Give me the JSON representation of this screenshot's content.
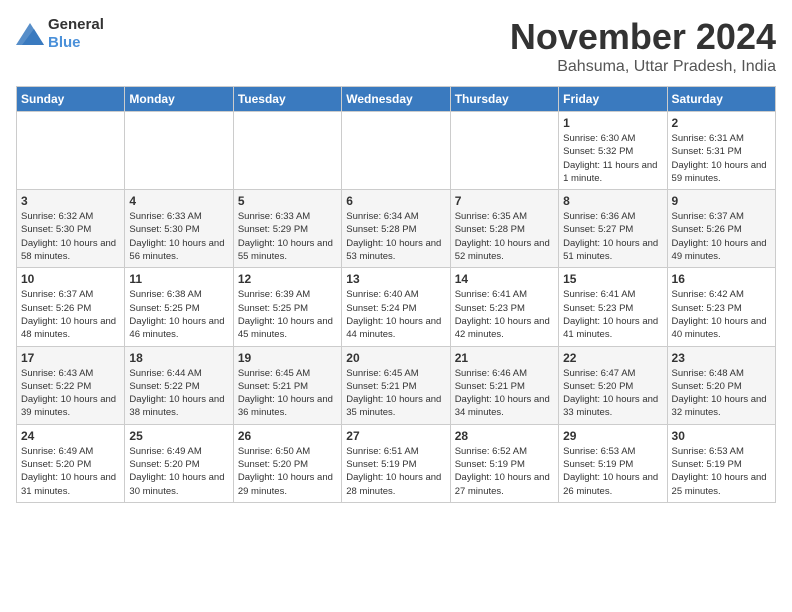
{
  "logo": {
    "general": "General",
    "blue": "Blue"
  },
  "header": {
    "month": "November 2024",
    "location": "Bahsuma, Uttar Pradesh, India"
  },
  "weekdays": [
    "Sunday",
    "Monday",
    "Tuesday",
    "Wednesday",
    "Thursday",
    "Friday",
    "Saturday"
  ],
  "weeks": [
    [
      {
        "day": "",
        "info": ""
      },
      {
        "day": "",
        "info": ""
      },
      {
        "day": "",
        "info": ""
      },
      {
        "day": "",
        "info": ""
      },
      {
        "day": "",
        "info": ""
      },
      {
        "day": "1",
        "info": "Sunrise: 6:30 AM\nSunset: 5:32 PM\nDaylight: 11 hours and 1 minute."
      },
      {
        "day": "2",
        "info": "Sunrise: 6:31 AM\nSunset: 5:31 PM\nDaylight: 10 hours and 59 minutes."
      }
    ],
    [
      {
        "day": "3",
        "info": "Sunrise: 6:32 AM\nSunset: 5:30 PM\nDaylight: 10 hours and 58 minutes."
      },
      {
        "day": "4",
        "info": "Sunrise: 6:33 AM\nSunset: 5:30 PM\nDaylight: 10 hours and 56 minutes."
      },
      {
        "day": "5",
        "info": "Sunrise: 6:33 AM\nSunset: 5:29 PM\nDaylight: 10 hours and 55 minutes."
      },
      {
        "day": "6",
        "info": "Sunrise: 6:34 AM\nSunset: 5:28 PM\nDaylight: 10 hours and 53 minutes."
      },
      {
        "day": "7",
        "info": "Sunrise: 6:35 AM\nSunset: 5:28 PM\nDaylight: 10 hours and 52 minutes."
      },
      {
        "day": "8",
        "info": "Sunrise: 6:36 AM\nSunset: 5:27 PM\nDaylight: 10 hours and 51 minutes."
      },
      {
        "day": "9",
        "info": "Sunrise: 6:37 AM\nSunset: 5:26 PM\nDaylight: 10 hours and 49 minutes."
      }
    ],
    [
      {
        "day": "10",
        "info": "Sunrise: 6:37 AM\nSunset: 5:26 PM\nDaylight: 10 hours and 48 minutes."
      },
      {
        "day": "11",
        "info": "Sunrise: 6:38 AM\nSunset: 5:25 PM\nDaylight: 10 hours and 46 minutes."
      },
      {
        "day": "12",
        "info": "Sunrise: 6:39 AM\nSunset: 5:25 PM\nDaylight: 10 hours and 45 minutes."
      },
      {
        "day": "13",
        "info": "Sunrise: 6:40 AM\nSunset: 5:24 PM\nDaylight: 10 hours and 44 minutes."
      },
      {
        "day": "14",
        "info": "Sunrise: 6:41 AM\nSunset: 5:23 PM\nDaylight: 10 hours and 42 minutes."
      },
      {
        "day": "15",
        "info": "Sunrise: 6:41 AM\nSunset: 5:23 PM\nDaylight: 10 hours and 41 minutes."
      },
      {
        "day": "16",
        "info": "Sunrise: 6:42 AM\nSunset: 5:23 PM\nDaylight: 10 hours and 40 minutes."
      }
    ],
    [
      {
        "day": "17",
        "info": "Sunrise: 6:43 AM\nSunset: 5:22 PM\nDaylight: 10 hours and 39 minutes."
      },
      {
        "day": "18",
        "info": "Sunrise: 6:44 AM\nSunset: 5:22 PM\nDaylight: 10 hours and 38 minutes."
      },
      {
        "day": "19",
        "info": "Sunrise: 6:45 AM\nSunset: 5:21 PM\nDaylight: 10 hours and 36 minutes."
      },
      {
        "day": "20",
        "info": "Sunrise: 6:45 AM\nSunset: 5:21 PM\nDaylight: 10 hours and 35 minutes."
      },
      {
        "day": "21",
        "info": "Sunrise: 6:46 AM\nSunset: 5:21 PM\nDaylight: 10 hours and 34 minutes."
      },
      {
        "day": "22",
        "info": "Sunrise: 6:47 AM\nSunset: 5:20 PM\nDaylight: 10 hours and 33 minutes."
      },
      {
        "day": "23",
        "info": "Sunrise: 6:48 AM\nSunset: 5:20 PM\nDaylight: 10 hours and 32 minutes."
      }
    ],
    [
      {
        "day": "24",
        "info": "Sunrise: 6:49 AM\nSunset: 5:20 PM\nDaylight: 10 hours and 31 minutes."
      },
      {
        "day": "25",
        "info": "Sunrise: 6:49 AM\nSunset: 5:20 PM\nDaylight: 10 hours and 30 minutes."
      },
      {
        "day": "26",
        "info": "Sunrise: 6:50 AM\nSunset: 5:20 PM\nDaylight: 10 hours and 29 minutes."
      },
      {
        "day": "27",
        "info": "Sunrise: 6:51 AM\nSunset: 5:19 PM\nDaylight: 10 hours and 28 minutes."
      },
      {
        "day": "28",
        "info": "Sunrise: 6:52 AM\nSunset: 5:19 PM\nDaylight: 10 hours and 27 minutes."
      },
      {
        "day": "29",
        "info": "Sunrise: 6:53 AM\nSunset: 5:19 PM\nDaylight: 10 hours and 26 minutes."
      },
      {
        "day": "30",
        "info": "Sunrise: 6:53 AM\nSunset: 5:19 PM\nDaylight: 10 hours and 25 minutes."
      }
    ]
  ]
}
